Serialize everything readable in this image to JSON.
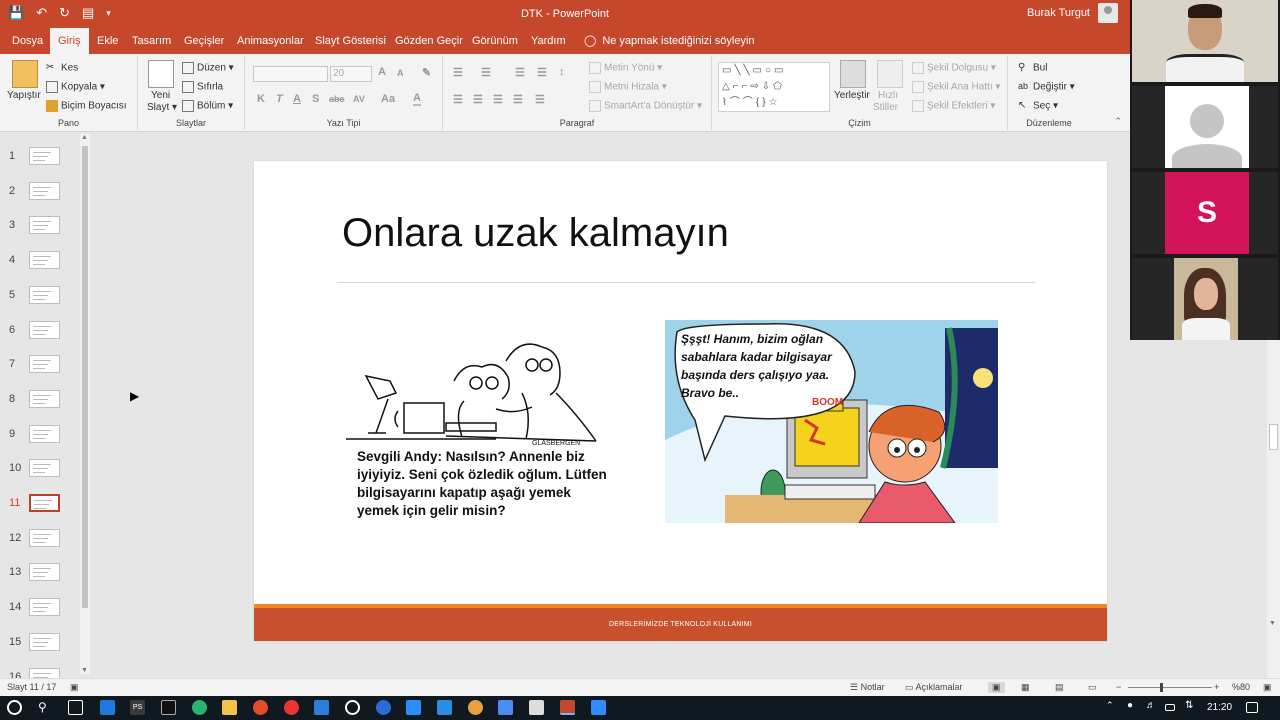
{
  "titlebar": {
    "title": "DTK  -  PowerPoint",
    "user": "Burak Turgut"
  },
  "tabs": [
    "Dosya",
    "Giriş",
    "Ekle",
    "Tasarım",
    "Geçişler",
    "Animasyonlar",
    "Slayt Gösterisi",
    "Gözden Geçir",
    "Görünüm",
    "Yardım"
  ],
  "active_tab": "Giriş",
  "tell_me": "Ne yapmak istediğinizi söyleyin",
  "ribbon": {
    "pano": {
      "label": "Pano",
      "paste": "Yapıştır",
      "cut": "Kes",
      "copy": "Kopyala",
      "format_painter": "Biçim Boyacısı"
    },
    "slaytlar": {
      "label": "Slaytlar",
      "new_slide_line1": "Yeni",
      "new_slide_line2": "Slayt",
      "layout": "Düzen",
      "reset": "Sıfırla",
      "section": "Bölüm"
    },
    "yazi_tipi": {
      "label": "Yazı Tipi",
      "font_size": "20",
      "buttons": [
        "K",
        "T",
        "A",
        "S",
        "abc",
        "AV",
        "Aa",
        "A"
      ]
    },
    "paragraf": {
      "label": "Paragraf",
      "text_direction": "Metin Yönü",
      "align_text": "Metni Hizala",
      "smartart": "SmartArt'a Dönüştür"
    },
    "cizim": {
      "label": "Çizim",
      "arrange": "Yerleştir",
      "quick_styles_line1": "Hızlı",
      "quick_styles_line2": "Stiller",
      "shape_fill": "Şekil Dolgusu",
      "shape_outline": "Şekil Ana Hattı",
      "shape_effects": "Şekil Efektleri"
    },
    "duzenleme": {
      "label": "Düzenleme",
      "find": "Bul",
      "replace": "Değiştir",
      "select": "Seç"
    }
  },
  "thumbnails": {
    "numbers": [
      "1",
      "2",
      "3",
      "4",
      "5",
      "6",
      "7",
      "8",
      "9",
      "10",
      "11",
      "12",
      "13",
      "14",
      "15",
      "16"
    ],
    "active": "11"
  },
  "slide": {
    "title": "Onlara uzak kalmayın",
    "caption": "Sevgili Andy: Nasılsın? Annenle biz iyiyiyiz. Seni çok özledik oğlum. Lütfen bilgisayarını kapatıp aşağı yemek yemek için gelir misin?",
    "signature": "GLASBERGEN",
    "bubble": "Şşşt! Hanım, bizim oğlan sabahlara kadar bilgisayar başında ders çalışıyo yaa. Bravo be..",
    "boom": "BOOM",
    "footer": "DERSLERİMİZDE TEKNOLOJİ KULLANIMI"
  },
  "statusbar": {
    "slide_info": "Slayt 11 / 17",
    "notes": "Notlar",
    "comments": "Açıklamalar",
    "zoom": "%80"
  },
  "taskbar": {
    "clock": "21:20"
  },
  "participants": {
    "letter": "S"
  },
  "colors": {
    "accent": "#c5472c",
    "slide_footer": "#c8502c",
    "footer_stripe": "#f08a1e",
    "avatar_pink": "#d4145a"
  }
}
